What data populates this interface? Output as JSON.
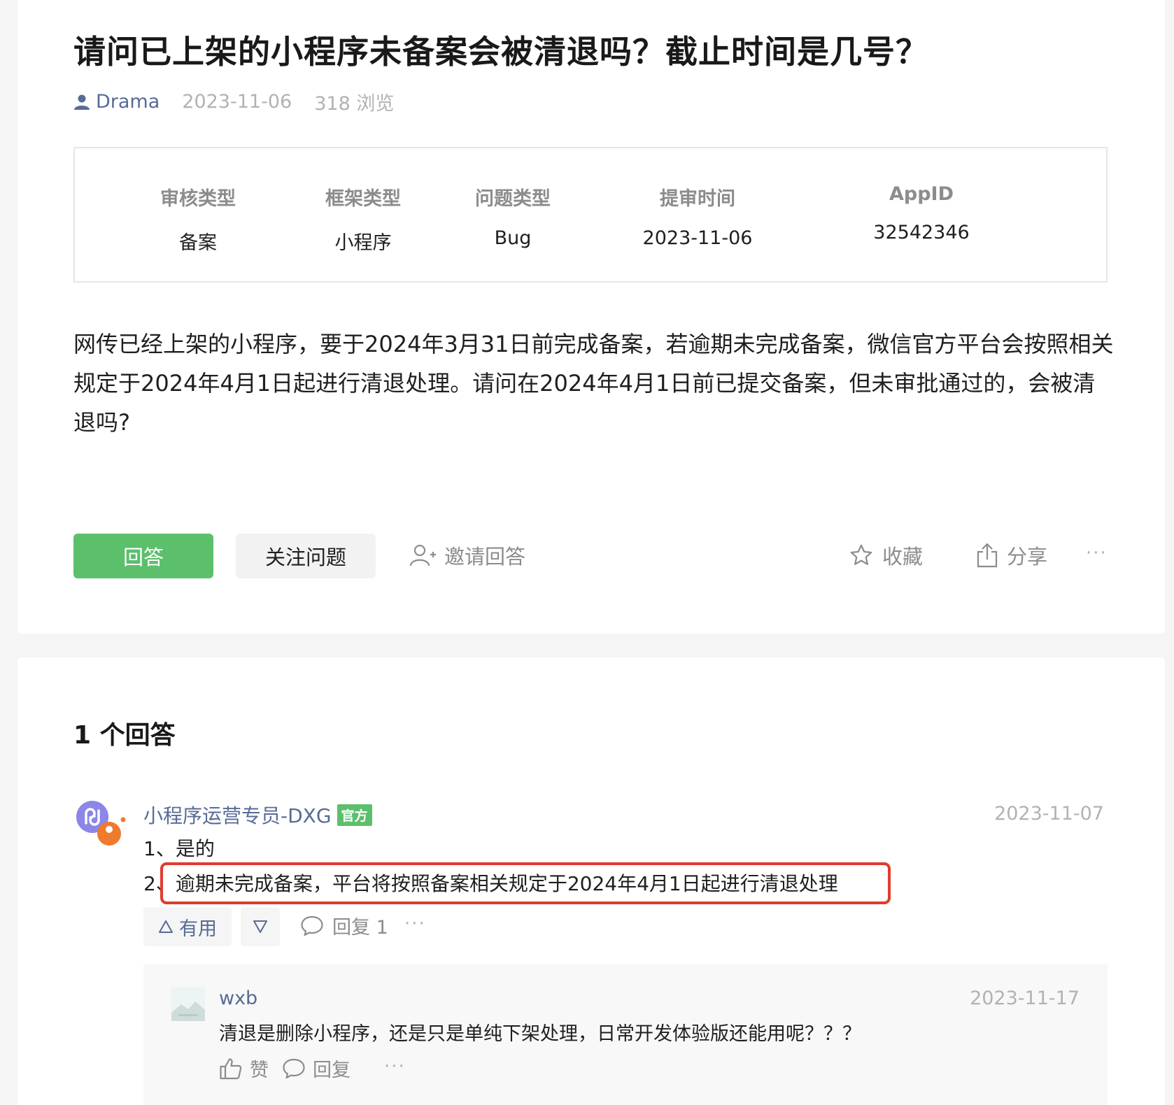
{
  "question": {
    "title": "请问已上架的小程序未备案会被清退吗？截止时间是几号？",
    "author": "Drama",
    "date": "2023-11-06",
    "views": "318 浏览",
    "info": [
      {
        "label": "审核类型",
        "value": "备案"
      },
      {
        "label": "框架类型",
        "value": "小程序"
      },
      {
        "label": "问题类型",
        "value": "Bug"
      },
      {
        "label": "提审时间",
        "value": "2023-11-06"
      },
      {
        "label": "AppID",
        "value": "32542346"
      }
    ],
    "body": "网传已经上架的小程序，要于2024年3月31日前完成备案，若逾期未完成备案，微信官方平台会按照相关规定于2024年4月1日起进行清退处理。请问在2024年4月1日前已提交备案，但未审批通过的，会被清退吗?",
    "actions": {
      "answer": "回答",
      "follow": "关注问题",
      "invite": "邀请回答",
      "favorite": "收藏",
      "share": "分享",
      "more": "···"
    }
  },
  "answers": {
    "count_label": "1 个回答",
    "items": [
      {
        "user": "小程序运营专员-DXG",
        "badge": "官方",
        "date": "2023-11-07",
        "lines": [
          "1、是的",
          "2、逾期未完成备案，平台将按照备案相关规定于2024年4月1日起进行清退处理"
        ],
        "useful_label": "有用",
        "reply_label": "回复 1",
        "more": "···",
        "replies": [
          {
            "user": "wxb",
            "date": "2023-11-17",
            "text": "清退是删除小程序，还是只是单纯下架处理，日常开发体验版还能用呢？？？",
            "like_label": "赞",
            "reply_label": "回复",
            "more": "···"
          }
        ]
      }
    ]
  },
  "colors": {
    "accent_green": "#5cbf6c",
    "link_blue": "#576b95",
    "highlight_red": "#e03c2e",
    "muted_gray": "#b2b2b2"
  }
}
